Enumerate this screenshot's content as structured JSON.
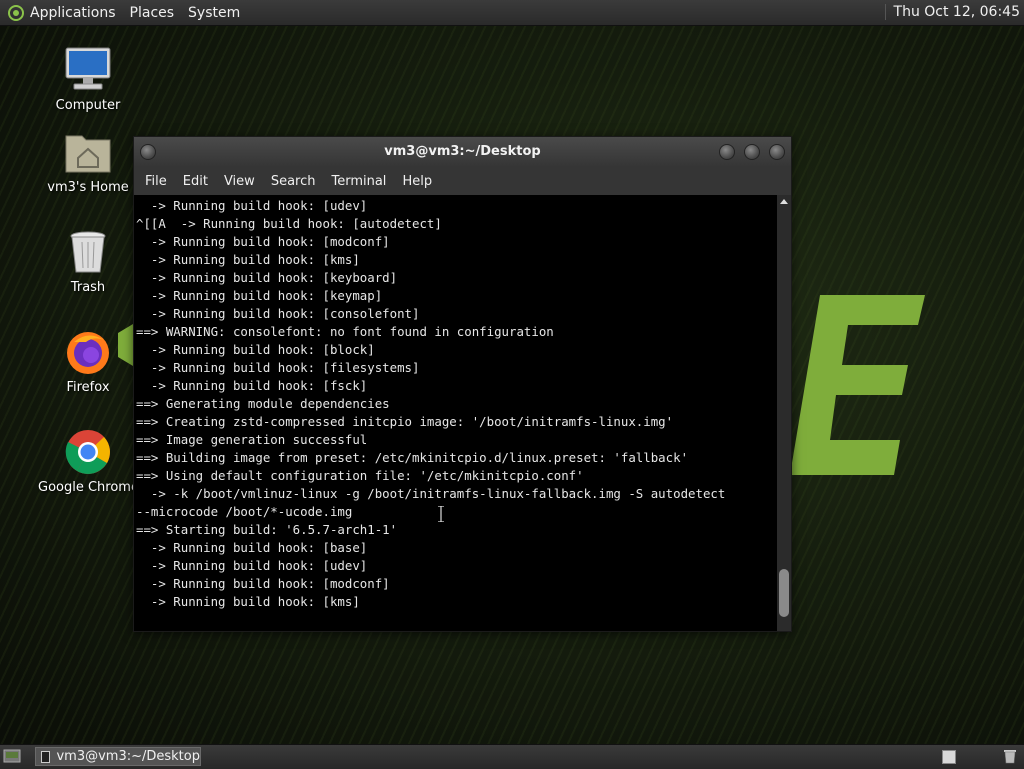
{
  "top_panel": {
    "menus": [
      "Applications",
      "Places",
      "System"
    ],
    "clock": "Thu Oct 12, 06:45"
  },
  "desktop_icons": [
    {
      "label": "Computer",
      "icon": "computer-icon"
    },
    {
      "label": "vm3's Home",
      "icon": "home-folder-icon"
    },
    {
      "label": "Trash",
      "icon": "trash-icon"
    },
    {
      "label": "Firefox",
      "icon": "firefox-icon"
    },
    {
      "label": "Google Chrome",
      "icon": "chrome-icon"
    }
  ],
  "terminal": {
    "title": "vm3@vm3:~/Desktop",
    "menu": [
      "File",
      "Edit",
      "View",
      "Search",
      "Terminal",
      "Help"
    ],
    "lines": [
      "  -> Running build hook: [udev]",
      "^[[A  -> Running build hook: [autodetect]",
      "  -> Running build hook: [modconf]",
      "  -> Running build hook: [kms]",
      "  -> Running build hook: [keyboard]",
      "  -> Running build hook: [keymap]",
      "  -> Running build hook: [consolefont]",
      "==> WARNING: consolefont: no font found in configuration",
      "  -> Running build hook: [block]",
      "  -> Running build hook: [filesystems]",
      "  -> Running build hook: [fsck]",
      "==> Generating module dependencies",
      "==> Creating zstd-compressed initcpio image: '/boot/initramfs-linux.img'",
      "==> Image generation successful",
      "==> Building image from preset: /etc/mkinitcpio.d/linux.preset: 'fallback'",
      "==> Using default configuration file: '/etc/mkinitcpio.conf'",
      "  -> -k /boot/vmlinuz-linux -g /boot/initramfs-linux-fallback.img -S autodetect",
      "--microcode /boot/*-ucode.img",
      "==> Starting build: '6.5.7-arch1-1'",
      "  -> Running build hook: [base]",
      "  -> Running build hook: [udev]",
      "  -> Running build hook: [modconf]",
      "  -> Running build hook: [kms]"
    ]
  },
  "taskbar": {
    "task_label": "vm3@vm3:~/Desktop"
  },
  "colors": {
    "accent": "#8bc34a",
    "terminal_bg": "#000000",
    "terminal_fg": "#e6e6e6"
  }
}
